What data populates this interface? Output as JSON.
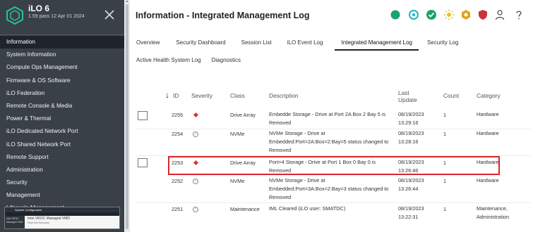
{
  "sidebar": {
    "app_name": "iLO 6",
    "version": "1.59 pass 12 Apr 01 2024",
    "items": [
      {
        "label": "Information",
        "active": true
      },
      {
        "label": "System Information"
      },
      {
        "label": "Compute Ops Management"
      },
      {
        "label": "Firmware & OS Software"
      },
      {
        "label": "iLO Federation"
      },
      {
        "label": "Remote Console & Media"
      },
      {
        "label": "Power & Thermal"
      },
      {
        "label": "iLO Dedicated Network Port"
      },
      {
        "label": "iLO Shared Network Port"
      },
      {
        "label": "Remote Support"
      },
      {
        "label": "Administration"
      },
      {
        "label": "Security"
      },
      {
        "label": "Management"
      },
      {
        "label": "Lifecycle Management"
      }
    ],
    "thumbnail": {
      "bar_text": "System Configuration",
      "side_text": "Intel VROC Managed VMD",
      "title": "Intel VROC Managed VMD",
      "subtitle": "Drive Info Summary"
    }
  },
  "header": {
    "title": "Information - Integrated Management Log",
    "status_icons": [
      "health-green-icon",
      "target-teal-icon",
      "check-green-icon",
      "sun-yellow-icon",
      "hexagon-amber-icon",
      "shield-red-icon",
      "user-icon",
      "help-icon"
    ],
    "status_colors": {
      "green": "#1aa36b",
      "teal": "#1bb5c4",
      "yellow": "#e6c230",
      "amber": "#e3a21a",
      "red": "#c8343b"
    }
  },
  "tabs": [
    {
      "label": "Overview"
    },
    {
      "label": "Security Dashboard"
    },
    {
      "label": "Session List"
    },
    {
      "label": "iLO Event Log"
    },
    {
      "label": "Integrated Management Log",
      "active": true
    },
    {
      "label": "Security Log"
    }
  ],
  "tabs_row2": [
    {
      "label": "Active Health System Log"
    },
    {
      "label": "Diagnostics"
    }
  ],
  "table": {
    "columns": {
      "id": "ID",
      "severity": "Severity",
      "class": "Class",
      "description": "Description",
      "last_update_line1": "Last",
      "last_update_line2": "Update",
      "count": "Count",
      "category": "Category"
    },
    "rows": [
      {
        "id": "2255",
        "severity": "critical",
        "class": "Drive Array",
        "description": "Embedde Storage - Drive at Port 2A Box 2 Bay 5 is Removed",
        "date": "08/19/2023",
        "time": "13:29:16",
        "count": "1",
        "category": "Hardware",
        "checkbox": true
      },
      {
        "id": "2254",
        "severity": "info",
        "class": "NVMe",
        "description": "NVMe Storage - Drive at Embedded:Port=2A:Box=2:Bay=5 status changed to Removed",
        "date": "08/19/2023",
        "time": "13:28:16",
        "count": "1",
        "category": "Hardware",
        "checkbox": false
      },
      {
        "id": "2253",
        "severity": "critical",
        "class": "Drive Array",
        "description": "Port=4 Storage - Drive at Port 1 Box 0 Bay 0 is Removed",
        "date": "08/19/2023",
        "time": "13:26:46",
        "count": "1",
        "category": "Hardware",
        "checkbox": true,
        "highlighted": true
      },
      {
        "id": "2252",
        "severity": "info",
        "class": "NVMe",
        "description": "NVMe Storage - Drive at Embedded:Port=3A:Box=2:Bay=3 status changed to Removed",
        "date": "08/19/2023",
        "time": "13:26:44",
        "count": "1",
        "category": "Hardware",
        "checkbox": false
      },
      {
        "id": "2251",
        "severity": "info",
        "class": "Maintenance",
        "description": "IML Cleared (iLO user: SMATDC)",
        "date": "08/19/2023",
        "time": "13:22:31",
        "count": "1",
        "category": "Maintenance, Administration",
        "checkbox": false
      }
    ]
  }
}
